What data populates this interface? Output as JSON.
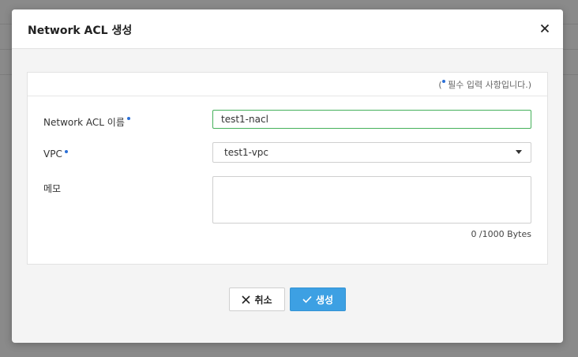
{
  "modal": {
    "title": "Network ACL 생성"
  },
  "form": {
    "required_note_open": "(",
    "required_note_text": "필수 입력 사항입니다.)",
    "name_label": "Network ACL 이름",
    "name_value": "test1-nacl",
    "vpc_label": "VPC",
    "vpc_value": "test1-vpc",
    "memo_label": "메모",
    "memo_value": "",
    "byte_count": "0 /1000 Bytes"
  },
  "buttons": {
    "cancel_label": "취소",
    "create_label": "생성"
  },
  "colors": {
    "accent": "#3da0e3",
    "required_dot": "#2b6fd6",
    "focus_border": "#45b05a"
  },
  "icons": {
    "close": "close-icon",
    "cancel": "x-icon",
    "create": "check-icon",
    "dropdown": "caret-down-icon"
  }
}
